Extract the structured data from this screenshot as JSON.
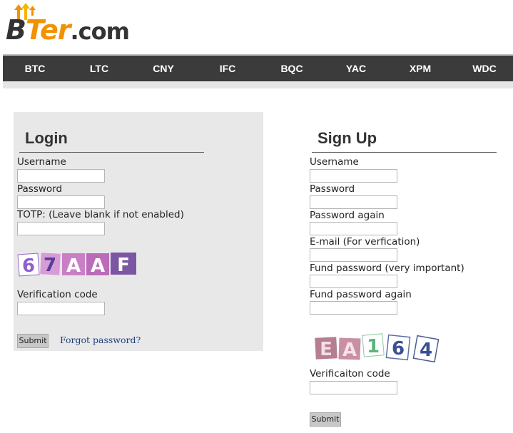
{
  "logo": {
    "part_b": "B",
    "part_ter": "Ter",
    "part_com": ".com"
  },
  "nav": {
    "items": [
      "BTC",
      "LTC",
      "CNY",
      "IFC",
      "BQC",
      "YAC",
      "XPM",
      "WDC"
    ]
  },
  "login": {
    "title": "Login",
    "username_label": "Username",
    "password_label": "Password",
    "totp_label": "TOTP: (Leave blank if not enabled)",
    "captcha_text": "67AAF",
    "verification_label": "Verification code",
    "submit_label": "Submit",
    "forgot_label": "Forgot password?"
  },
  "signup": {
    "title": "Sign Up",
    "username_label": "Username",
    "password_label": "Password",
    "password_again_label": "Password again",
    "email_label": "E-mail (For verfication)",
    "fund_password_label": "Fund password (very important)",
    "fund_password_again_label": "Fund password again",
    "captcha_text": "EA164",
    "verification_label": "Verificaiton code",
    "submit_label": "Submit"
  },
  "colors": {
    "brand_orange": "#f39200",
    "nav_bg": "#3b3b3b",
    "panel_bg": "#e8e8e8",
    "link": "#1f3f7a"
  }
}
